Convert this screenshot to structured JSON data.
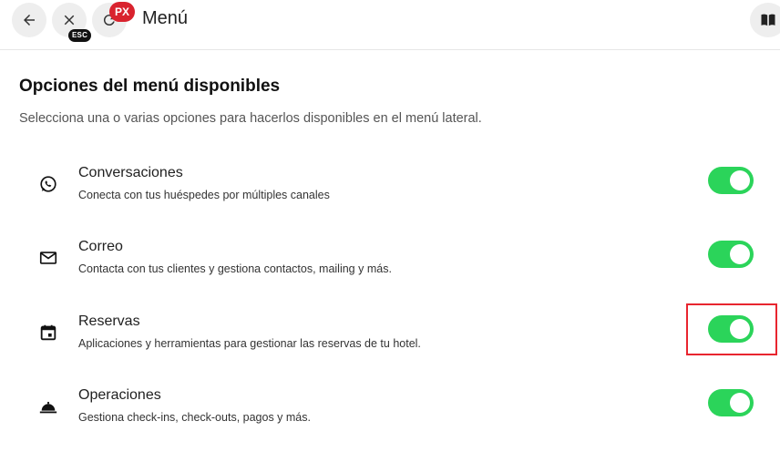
{
  "header": {
    "title": "Menú",
    "esc_badge": "ESC",
    "px_badge": "PX",
    "icons": [
      "arrow-left-icon",
      "close-icon",
      "refresh-icon",
      "book-icon"
    ]
  },
  "section": {
    "title": "Opciones del menú disponibles",
    "description": "Selecciona una o varias opciones para hacerlos disponibles en el menú lateral."
  },
  "options": [
    {
      "label": "Conversaciones",
      "description": "Conecta con tus huéspedes por múltiples canales",
      "icon": "whatsapp-icon",
      "enabled": true
    },
    {
      "label": "Correo",
      "description": "Contacta con tus clientes y gestiona contactos, mailing y más.",
      "icon": "mail-icon",
      "enabled": true
    },
    {
      "label": "Reservas",
      "description": "Aplicaciones y herramientas para gestionar las reservas de tu hotel.",
      "icon": "calendar-icon",
      "enabled": true
    },
    {
      "label": "Operaciones",
      "description": "Gestiona check-ins, check-outs, pagos y más.",
      "icon": "room-service-icon",
      "enabled": true
    }
  ],
  "colors": {
    "toggle_on": "#2bd45a",
    "highlight": "#e8252f",
    "badge_red": "#d9232e"
  }
}
